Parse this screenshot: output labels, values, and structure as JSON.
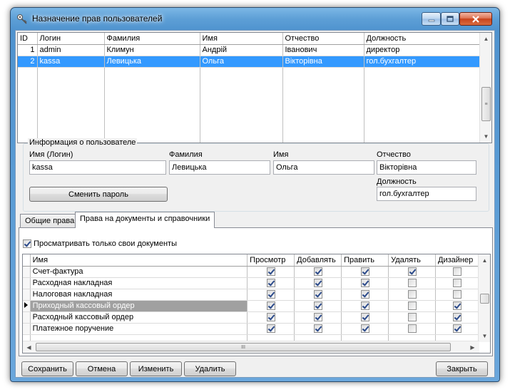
{
  "window": {
    "title": "Назначение прав пользователей"
  },
  "users": {
    "columns": [
      "ID",
      "Логин",
      "Фамилия",
      "Имя",
      "Отчество",
      "Должность"
    ],
    "rows": [
      {
        "id": "1",
        "login": "admin",
        "last": "Климун",
        "first": "Андрій",
        "middle": "Іванович",
        "position": "директор",
        "selected": false
      },
      {
        "id": "2",
        "login": "kassa",
        "last": "Левицька",
        "first": "Ольга",
        "middle": "Вікторівна",
        "position": "гол.бухгалтер",
        "selected": true
      }
    ]
  },
  "info": {
    "group_title": "Информация о пользователе",
    "login_label": "Имя (Логин)",
    "login_value": "kassa",
    "last_label": "Фамилия",
    "last_value": "Левицька",
    "first_label": "Имя",
    "first_value": "Ольга",
    "middle_label": "Отчество",
    "middle_value": "Вікторівна",
    "position_label": "Должность",
    "position_value": "гол.бухгалтер",
    "change_password": "Сменить пароль"
  },
  "tabs": [
    {
      "label": "Общие права",
      "active": false
    },
    {
      "label": "Права на документы и справочники",
      "active": true
    }
  ],
  "rights": {
    "own_docs_label": "Просматривать только свои документы",
    "own_docs_checked": true,
    "columns": [
      "Имя",
      "Просмотр",
      "Добавлять",
      "Править",
      "Удалять",
      "Дизайнер"
    ],
    "rows": [
      {
        "name": "Счет-фактура",
        "view": true,
        "add": true,
        "edit": true,
        "del": true,
        "design": false,
        "selected": false
      },
      {
        "name": "Расходная накладная",
        "view": true,
        "add": true,
        "edit": true,
        "del": false,
        "design": false,
        "selected": false
      },
      {
        "name": "Налоговая накладная",
        "view": true,
        "add": true,
        "edit": true,
        "del": false,
        "design": false,
        "selected": false
      },
      {
        "name": "Приходный кассовый ордер",
        "view": true,
        "add": true,
        "edit": true,
        "del": false,
        "design": true,
        "selected": true
      },
      {
        "name": "Расходный кассовый ордер",
        "view": true,
        "add": true,
        "edit": true,
        "del": false,
        "design": true,
        "selected": false
      },
      {
        "name": "Платежное поручение",
        "view": true,
        "add": true,
        "edit": true,
        "del": false,
        "design": true,
        "selected": false
      }
    ],
    "hscroll_thumb_label": "III"
  },
  "buttons": {
    "save": "Сохранить",
    "cancel": "Отмена",
    "edit": "Изменить",
    "delete": "Удалить",
    "close": "Закрыть"
  },
  "icons": {
    "app": "key-icon",
    "minimize": "minimize-icon",
    "maximize": "maximize-icon",
    "close": "close-icon"
  }
}
